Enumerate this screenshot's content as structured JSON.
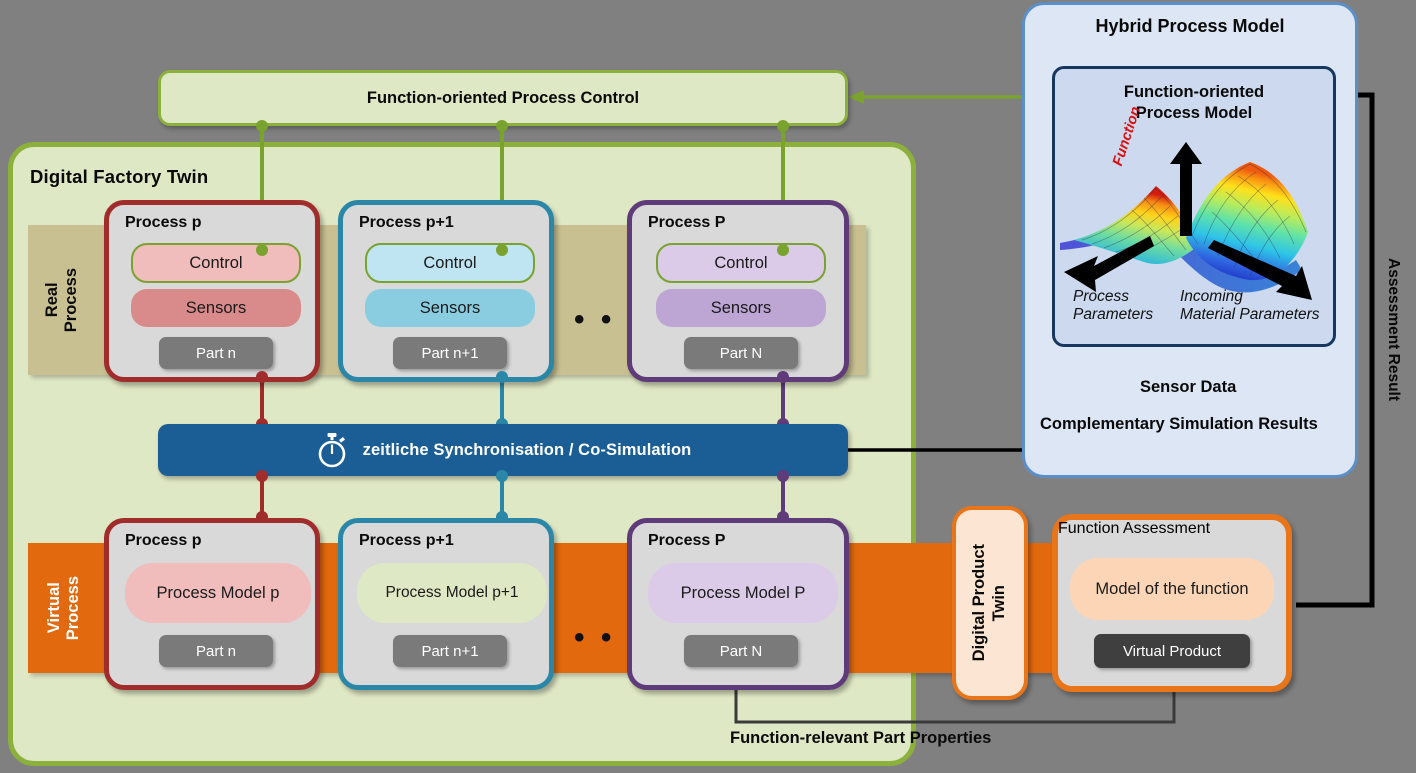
{
  "colors": {
    "background": "#808080",
    "factory_green_fill": "#dfe8c4",
    "factory_green_border": "#8bb03c",
    "hybrid_blue_fill": "#dde6f4",
    "hybrid_blue_border": "#5b8fc9",
    "model_box_fill": "#ccd9ee",
    "model_box_border": "#17375e",
    "cosim_blue": "#1b5e96",
    "real_band": "#c9c091",
    "virtual_band": "#e2690d",
    "orange_border": "#e8751a",
    "card_grey": "#d9d9d9",
    "part_grey": "#7a7a7a",
    "part_dark": "#3f3f3f",
    "process_p": "#a02c2c",
    "process_p1": "#2b87a8",
    "process_P": "#5f3b7a",
    "control_link_green": "#7aa22e"
  },
  "top_bar": {
    "label": "Function-oriented Process Control"
  },
  "factory": {
    "title": "Digital Factory Twin"
  },
  "bands": {
    "real": "Real\nProcess",
    "real_line1": "Real",
    "real_line2": "Process",
    "virtual_line1": "Virtual",
    "virtual_line2": "Process"
  },
  "cosim": {
    "label": "zeitliche Synchronisation / Co-Simulation",
    "icon": "stopwatch-icon"
  },
  "real_processes": [
    {
      "title": "Process p",
      "control": "Control",
      "sensors": "Sensors",
      "part": "Part n",
      "border": "#a02c2c",
      "control_fill": "#f0bcbc",
      "sensors_fill": "#d98a8a"
    },
    {
      "title": "Process p+1",
      "control": "Control",
      "sensors": "Sensors",
      "part": "Part n+1",
      "border": "#2b87a8",
      "control_fill": "#bfe5f2",
      "sensors_fill": "#8bcde0"
    },
    {
      "title": "Process P",
      "control": "Control",
      "sensors": "Sensors",
      "part": "Part N",
      "border": "#5f3b7a",
      "control_fill": "#dccbe8",
      "sensors_fill": "#bda5d4"
    }
  ],
  "virtual_processes": [
    {
      "title": "Process p",
      "model": "Process Model p",
      "part": "Part n",
      "border": "#a02c2c",
      "model_fill": "#f0bcbc"
    },
    {
      "title": "Process p+1",
      "model": "Process Model p+1",
      "part": "Part n+1",
      "border": "#2b87a8",
      "model_fill": "#dfe8c4"
    },
    {
      "title": "Process P",
      "model": "Process Model P",
      "part": "Part N",
      "border": "#5f3b7a",
      "model_fill": "#dccbe8"
    }
  ],
  "ellipsis": "• • •",
  "digital_product_twin": {
    "line1": "Digital Product",
    "line2": "Twin"
  },
  "function_assessment": {
    "title": "Function Assessment",
    "model": "Model of the function",
    "product": "Virtual Product",
    "model_fill": "#fbd5b5"
  },
  "hybrid": {
    "title": "Hybrid Process Model",
    "model_title_line1": "Function-oriented",
    "model_title_line2": "Process Model",
    "axis_function": "Function",
    "axis_process_line1": "Process",
    "axis_process_line2": "Parameters",
    "axis_material_line1": "Incoming",
    "axis_material_line2": "Material Parameters",
    "sensor_data": "Sensor Data",
    "complementary": "Complementary Simulation Results"
  },
  "edge_labels": {
    "assessment_result": "Assessment Result",
    "function_relevant": "Function-relevant Part Properties"
  }
}
